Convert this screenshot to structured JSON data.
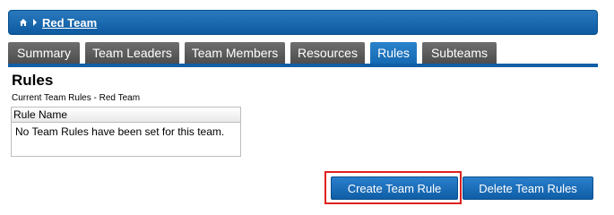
{
  "breadcrumb": {
    "home_icon": "home-icon",
    "separator_icon": "triangle-right-icon",
    "team_link": "Red Team"
  },
  "tabs": [
    {
      "label": "Summary",
      "active": false
    },
    {
      "label": "Team Leaders",
      "active": false
    },
    {
      "label": "Team Members",
      "active": false
    },
    {
      "label": "Resources",
      "active": false
    },
    {
      "label": "Rules",
      "active": true
    },
    {
      "label": "Subteams",
      "active": false
    }
  ],
  "main": {
    "title": "Rules",
    "subtitle": "Current Team Rules - Red Team",
    "table": {
      "column_header": "Rule Name",
      "empty_message": "No Team Rules have been set for this team."
    }
  },
  "actions": {
    "create_label": "Create Team Rule",
    "delete_label": "Delete Team Rules",
    "highlight_color": "#e02020"
  },
  "colors": {
    "header_blue": "#0d5aa0",
    "tab_gray": "#5a5a5a",
    "tab_active_blue": "#1669b2",
    "button_blue": "#0f5ea6"
  }
}
